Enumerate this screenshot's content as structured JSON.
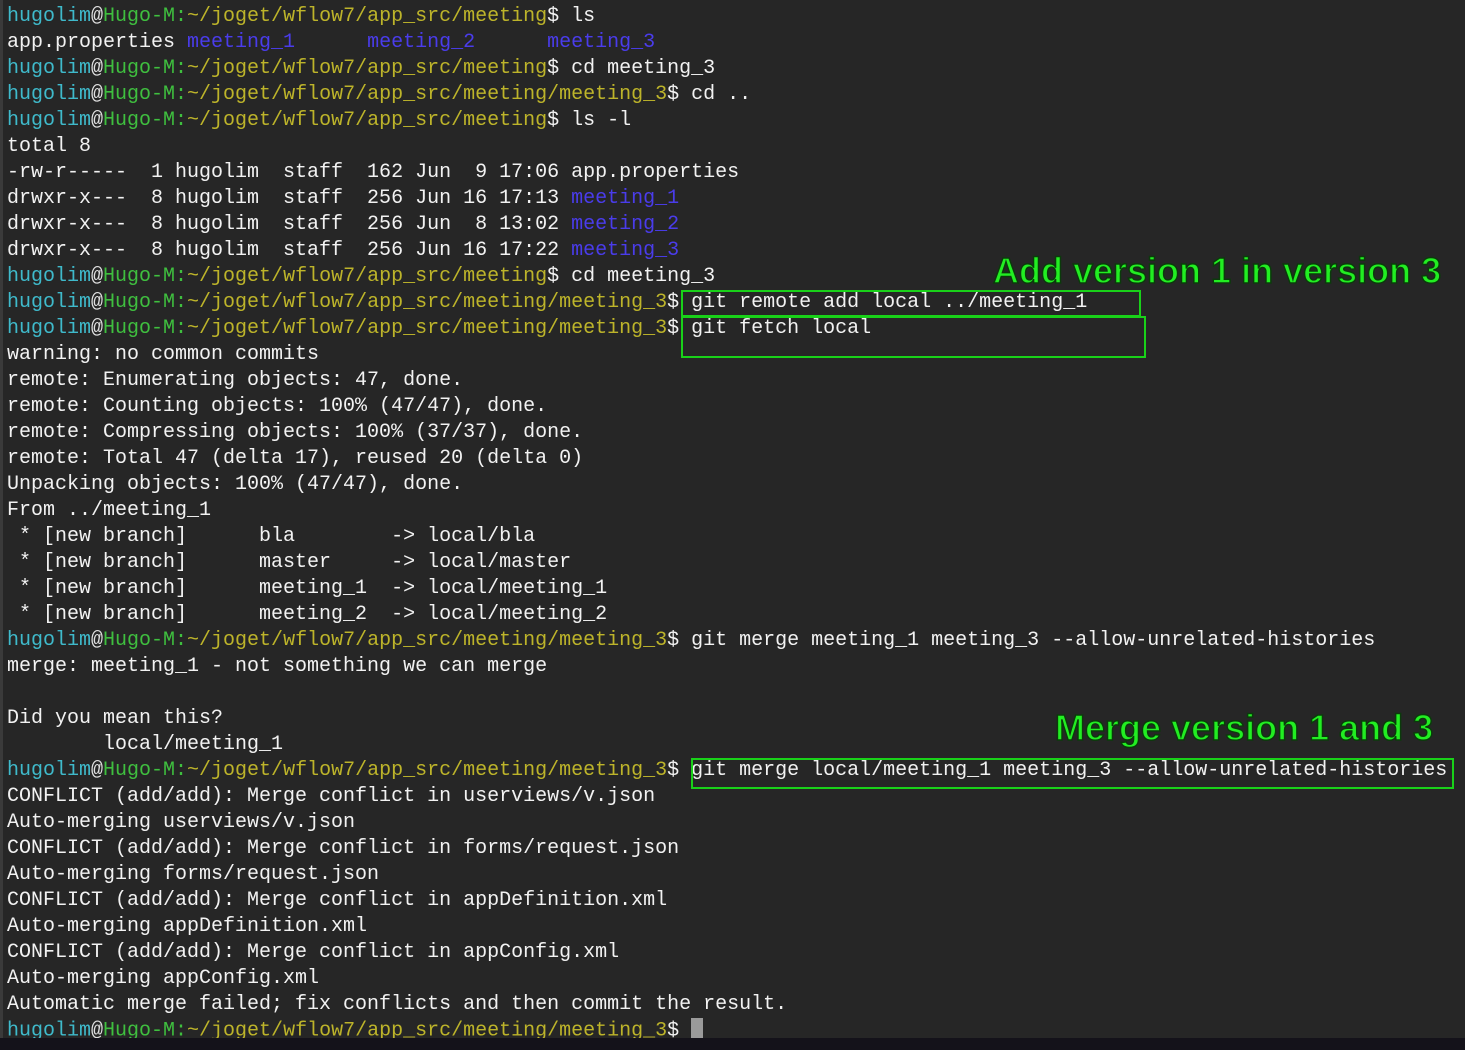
{
  "colors": {
    "background": "#262626",
    "user": "#3fbacb",
    "host": "#3fbf3f",
    "path": "#bdb42a",
    "directory": "#4a3ceb",
    "annotation": "#22ee22"
  },
  "annotations": {
    "add_version": "Add version 1 in version 3",
    "merge_version": "Merge version 1 and 3"
  },
  "lines": [
    [
      {
        "c": "u",
        "t": "hugolim"
      },
      {
        "c": "at",
        "t": "@"
      },
      {
        "c": "h",
        "t": "Hugo-M:"
      },
      {
        "c": "p",
        "t": "~/joget/wflow7/app_src/meeting"
      },
      {
        "c": "w",
        "t": "$ ls"
      }
    ],
    [
      {
        "c": "w",
        "t": "app.properties "
      },
      {
        "c": "d",
        "t": "meeting_1"
      },
      {
        "c": "w",
        "t": "      "
      },
      {
        "c": "d",
        "t": "meeting_2"
      },
      {
        "c": "w",
        "t": "      "
      },
      {
        "c": "d",
        "t": "meeting_3"
      }
    ],
    [
      {
        "c": "u",
        "t": "hugolim"
      },
      {
        "c": "at",
        "t": "@"
      },
      {
        "c": "h",
        "t": "Hugo-M:"
      },
      {
        "c": "p",
        "t": "~/joget/wflow7/app_src/meeting"
      },
      {
        "c": "w",
        "t": "$ cd meeting_3"
      }
    ],
    [
      {
        "c": "u",
        "t": "hugolim"
      },
      {
        "c": "at",
        "t": "@"
      },
      {
        "c": "h",
        "t": "Hugo-M:"
      },
      {
        "c": "p",
        "t": "~/joget/wflow7/app_src/meeting/meeting_3"
      },
      {
        "c": "w",
        "t": "$ cd .."
      }
    ],
    [
      {
        "c": "u",
        "t": "hugolim"
      },
      {
        "c": "at",
        "t": "@"
      },
      {
        "c": "h",
        "t": "Hugo-M:"
      },
      {
        "c": "p",
        "t": "~/joget/wflow7/app_src/meeting"
      },
      {
        "c": "w",
        "t": "$ ls -l"
      }
    ],
    [
      {
        "c": "w",
        "t": "total 8"
      }
    ],
    [
      {
        "c": "w",
        "t": "-rw-r-----  1 hugolim  staff  162 Jun  9 17:06 app.properties"
      }
    ],
    [
      {
        "c": "w",
        "t": "drwxr-x---  8 hugolim  staff  256 Jun 16 17:13 "
      },
      {
        "c": "d",
        "t": "meeting_1"
      }
    ],
    [
      {
        "c": "w",
        "t": "drwxr-x---  8 hugolim  staff  256 Jun  8 13:02 "
      },
      {
        "c": "d",
        "t": "meeting_2"
      }
    ],
    [
      {
        "c": "w",
        "t": "drwxr-x---  8 hugolim  staff  256 Jun 16 17:22 "
      },
      {
        "c": "d",
        "t": "meeting_3"
      }
    ],
    [
      {
        "c": "u",
        "t": "hugolim"
      },
      {
        "c": "at",
        "t": "@"
      },
      {
        "c": "h",
        "t": "Hugo-M:"
      },
      {
        "c": "p",
        "t": "~/joget/wflow7/app_src/meeting"
      },
      {
        "c": "w",
        "t": "$ cd meeting_3"
      }
    ],
    [
      {
        "c": "u",
        "t": "hugolim"
      },
      {
        "c": "at",
        "t": "@"
      },
      {
        "c": "h",
        "t": "Hugo-M:"
      },
      {
        "c": "p",
        "t": "~/joget/wflow7/app_src/meeting/meeting_3"
      },
      {
        "c": "w",
        "t": "$ git remote add local ../meeting_1"
      }
    ],
    [
      {
        "c": "u",
        "t": "hugolim"
      },
      {
        "c": "at",
        "t": "@"
      },
      {
        "c": "h",
        "t": "Hugo-M:"
      },
      {
        "c": "p",
        "t": "~/joget/wflow7/app_src/meeting/meeting_3"
      },
      {
        "c": "w",
        "t": "$ git fetch local"
      }
    ],
    [
      {
        "c": "w",
        "t": "warning: no common commits"
      }
    ],
    [
      {
        "c": "w",
        "t": "remote: Enumerating objects: 47, done."
      }
    ],
    [
      {
        "c": "w",
        "t": "remote: Counting objects: 100% (47/47), done."
      }
    ],
    [
      {
        "c": "w",
        "t": "remote: Compressing objects: 100% (37/37), done."
      }
    ],
    [
      {
        "c": "w",
        "t": "remote: Total 47 (delta 17), reused 20 (delta 0)"
      }
    ],
    [
      {
        "c": "w",
        "t": "Unpacking objects: 100% (47/47), done."
      }
    ],
    [
      {
        "c": "w",
        "t": "From ../meeting_1"
      }
    ],
    [
      {
        "c": "w",
        "t": " * [new branch]      bla        -> local/bla"
      }
    ],
    [
      {
        "c": "w",
        "t": " * [new branch]      master     -> local/master"
      }
    ],
    [
      {
        "c": "w",
        "t": " * [new branch]      meeting_1  -> local/meeting_1"
      }
    ],
    [
      {
        "c": "w",
        "t": " * [new branch]      meeting_2  -> local/meeting_2"
      }
    ],
    [
      {
        "c": "u",
        "t": "hugolim"
      },
      {
        "c": "at",
        "t": "@"
      },
      {
        "c": "h",
        "t": "Hugo-M:"
      },
      {
        "c": "p",
        "t": "~/joget/wflow7/app_src/meeting/meeting_3"
      },
      {
        "c": "w",
        "t": "$ git merge meeting_1 meeting_3 --allow-unrelated-histories"
      }
    ],
    [
      {
        "c": "w",
        "t": "merge: meeting_1 - not something we can merge"
      }
    ],
    [],
    [
      {
        "c": "w",
        "t": "Did you mean this?"
      }
    ],
    [
      {
        "c": "w",
        "t": "        local/meeting_1"
      }
    ],
    [
      {
        "c": "u",
        "t": "hugolim"
      },
      {
        "c": "at",
        "t": "@"
      },
      {
        "c": "h",
        "t": "Hugo-M:"
      },
      {
        "c": "p",
        "t": "~/joget/wflow7/app_src/meeting/meeting_3"
      },
      {
        "c": "w",
        "t": "$ git merge local/meeting_1 meeting_3 --allow-unrelated-histories"
      }
    ],
    [
      {
        "c": "w",
        "t": "CONFLICT (add/add): Merge conflict in userviews/v.json"
      }
    ],
    [
      {
        "c": "w",
        "t": "Auto-merging userviews/v.json"
      }
    ],
    [
      {
        "c": "w",
        "t": "CONFLICT (add/add): Merge conflict in forms/request.json"
      }
    ],
    [
      {
        "c": "w",
        "t": "Auto-merging forms/request.json"
      }
    ],
    [
      {
        "c": "w",
        "t": "CONFLICT (add/add): Merge conflict in appDefinition.xml"
      }
    ],
    [
      {
        "c": "w",
        "t": "Auto-merging appDefinition.xml"
      }
    ],
    [
      {
        "c": "w",
        "t": "CONFLICT (add/add): Merge conflict in appConfig.xml"
      }
    ],
    [
      {
        "c": "w",
        "t": "Auto-merging appConfig.xml"
      }
    ],
    [
      {
        "c": "w",
        "t": "Automatic merge failed; fix conflicts and then commit the result."
      }
    ],
    [
      {
        "c": "u",
        "t": "hugolim"
      },
      {
        "c": "at",
        "t": "@"
      },
      {
        "c": "h",
        "t": "Hugo-M:"
      },
      {
        "c": "p",
        "t": "~/joget/wflow7/app_src/meeting/meeting_3"
      },
      {
        "c": "w",
        "t": "$ "
      }
    ]
  ]
}
